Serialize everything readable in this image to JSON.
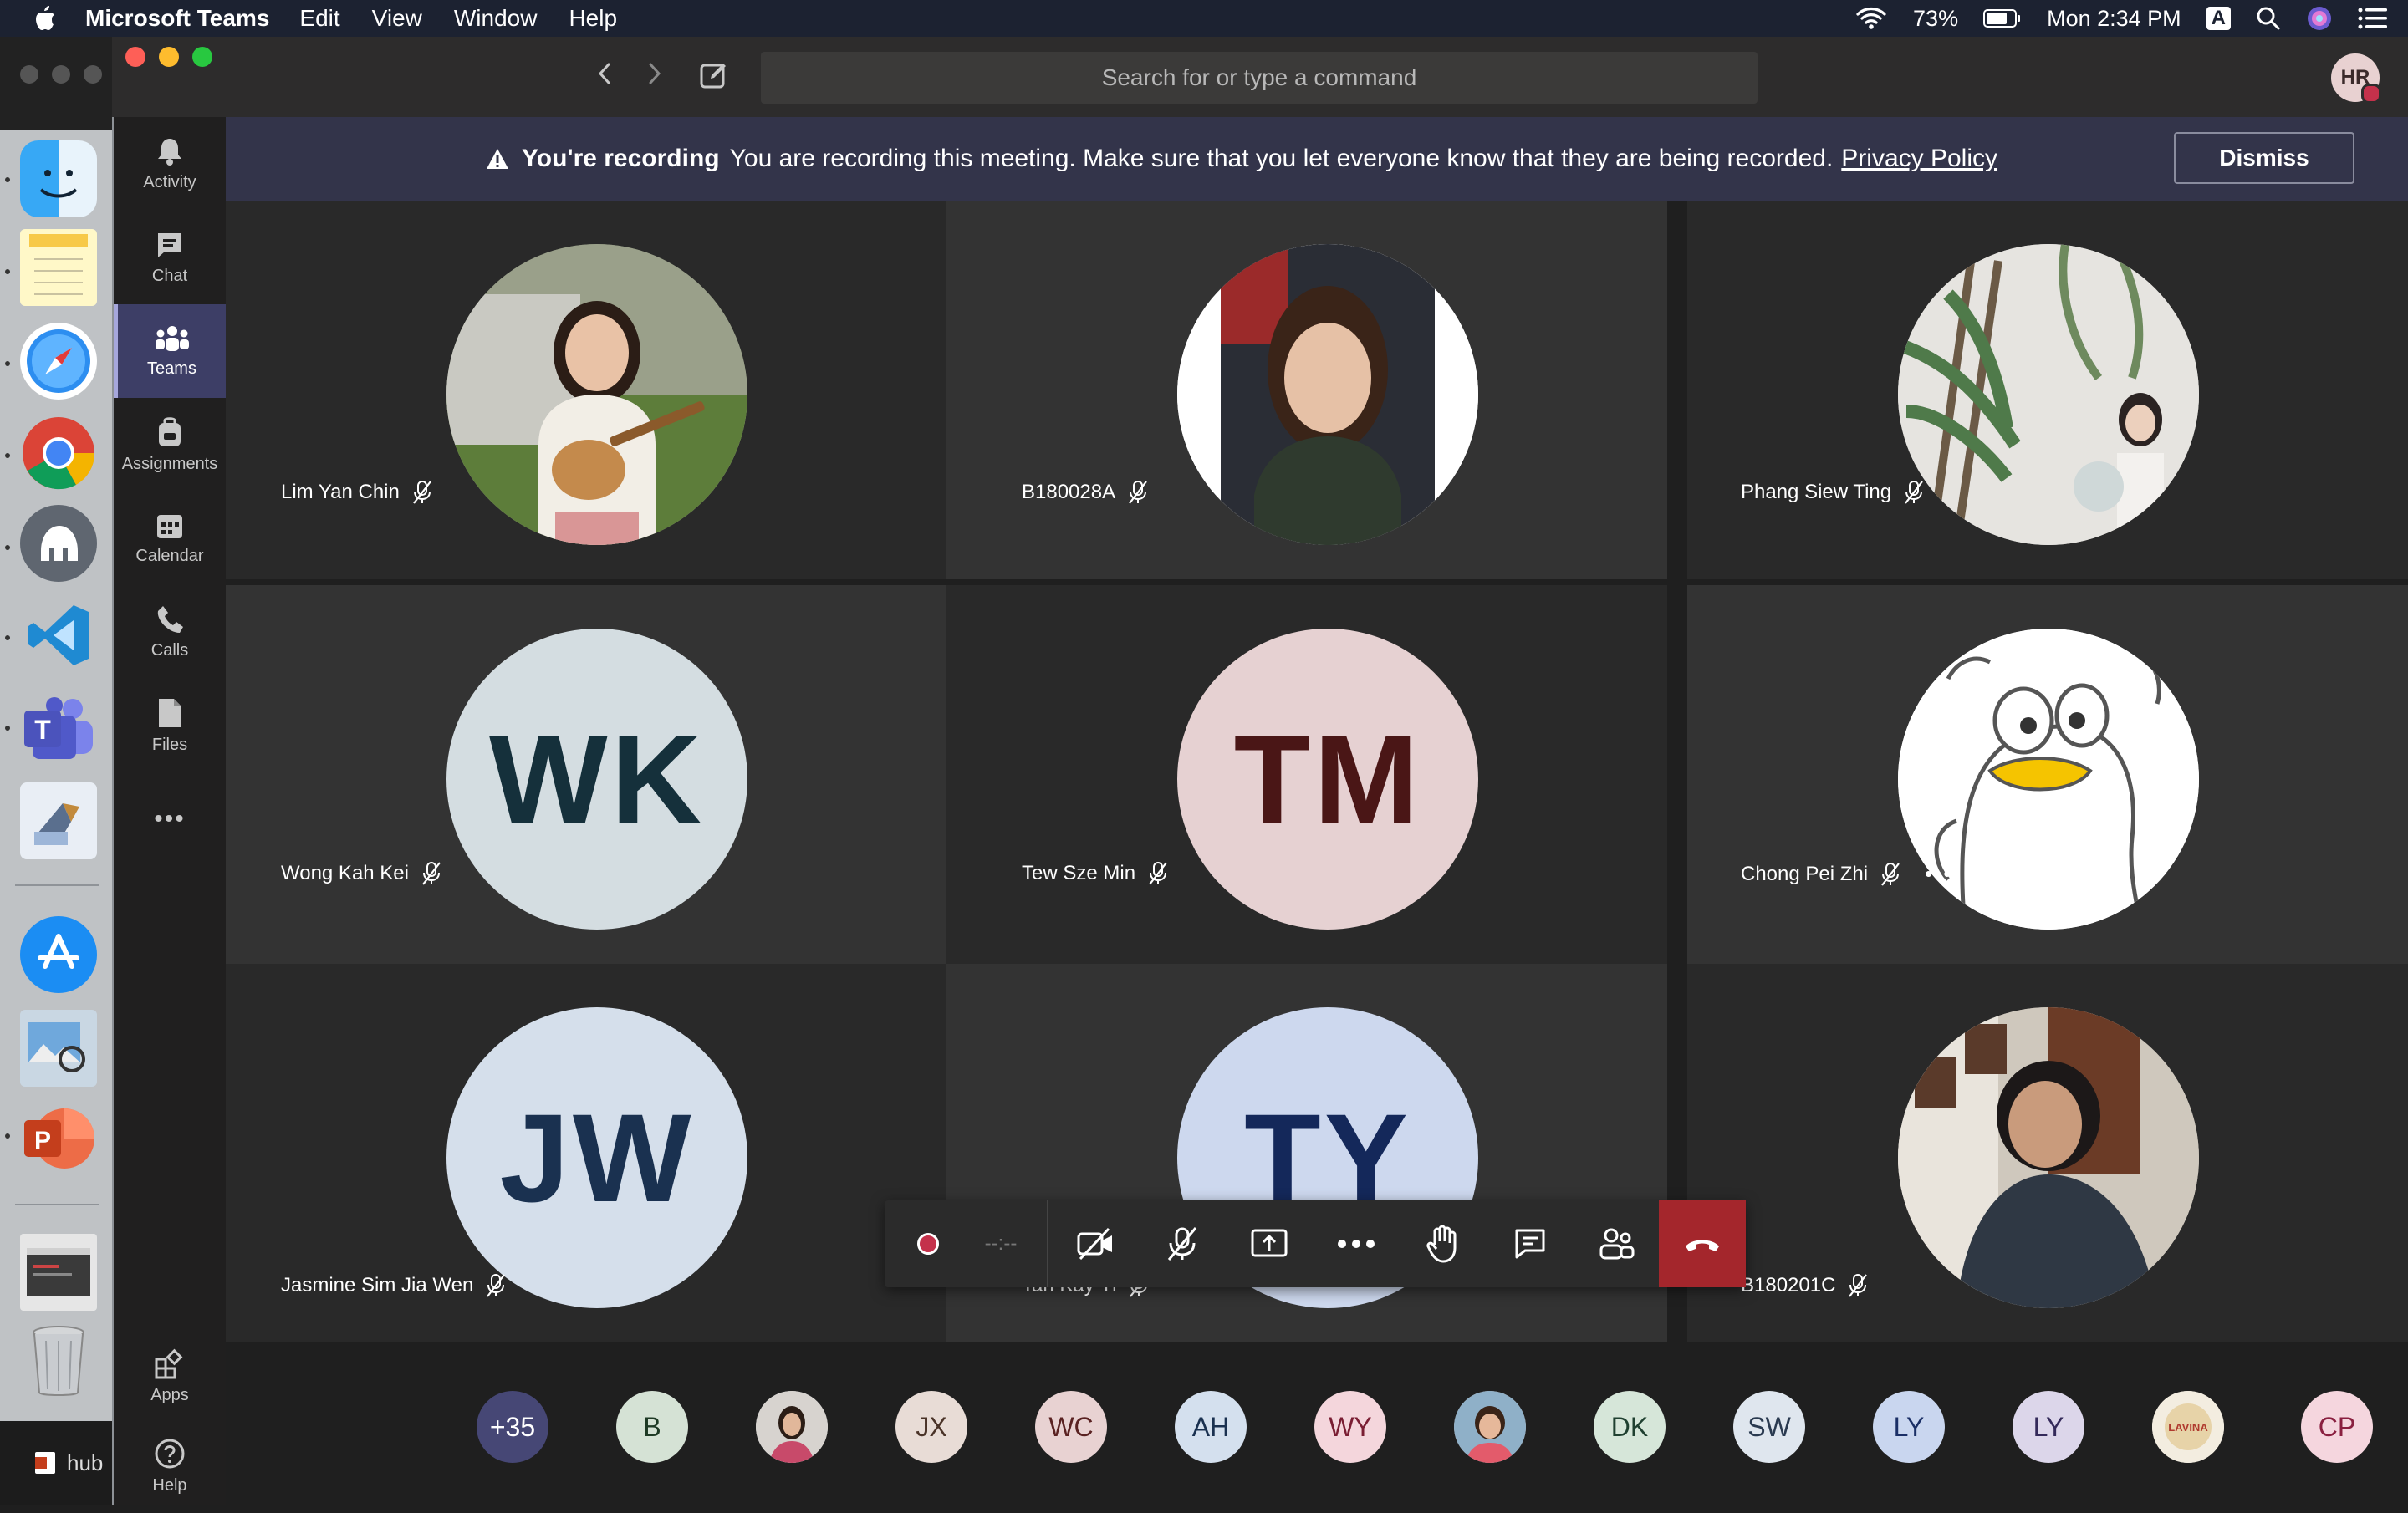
{
  "menubar": {
    "app_name": "Microsoft Teams",
    "items": [
      "Edit",
      "View",
      "Window",
      "Help"
    ],
    "battery": "73%",
    "clock": "Mon 2:34 PM",
    "input_source": "A"
  },
  "dock": {
    "apps": [
      "finder-icon",
      "notes-icon",
      "safari-icon",
      "chrome-icon",
      "tableplus-icon",
      "vscode-icon",
      "teams-icon",
      "mail-icon",
      "app-store-icon",
      "preview-icon",
      "powerpoint-icon",
      "window-icon",
      "trash-icon"
    ],
    "bottom_label": "hub"
  },
  "titlebar": {
    "search_placeholder": "Search for or type a command",
    "user_initials": "HR"
  },
  "rail": {
    "items": [
      "Activity",
      "Chat",
      "Teams",
      "Assignments",
      "Calendar",
      "Calls",
      "Files"
    ],
    "more": "•••",
    "apps": "Apps",
    "help": "Help"
  },
  "banner": {
    "title": "You're recording",
    "message": "You are recording this meeting. Make sure that you let everyone know that they are being recorded.",
    "link": "Privacy Policy",
    "dismiss": "Dismiss"
  },
  "participants": [
    {
      "name": "Lim Yan Chin",
      "initials": "",
      "avatar": "photo"
    },
    {
      "name": "B180028A",
      "initials": "",
      "avatar": "photo"
    },
    {
      "name": "Phang Siew Ting",
      "initials": "",
      "avatar": "photo"
    },
    {
      "name": "Wong Kah Kei",
      "initials": "WK"
    },
    {
      "name": "Tew Sze Min",
      "initials": "TM"
    },
    {
      "name": "Chong Pei Zhi",
      "initials": "",
      "avatar": "cartoon",
      "more": "•••"
    },
    {
      "name": "Jasmine Sim Jia Wen",
      "initials": "JW"
    },
    {
      "name": "Tan Kay Yi",
      "initials": "TY"
    },
    {
      "name": "B180201C",
      "initials": "",
      "avatar": "photo"
    }
  ],
  "controls": {
    "timer": "--:--"
  },
  "roster": [
    "+35",
    "B",
    "",
    "JX",
    "WC",
    "AH",
    "WY",
    "",
    "DK",
    "SW",
    "LY",
    "LY",
    "LAVINA",
    "CP"
  ],
  "colors": {
    "accent": "#a6a7dc",
    "hangup": "#a4262c",
    "banner": "#33344a"
  }
}
